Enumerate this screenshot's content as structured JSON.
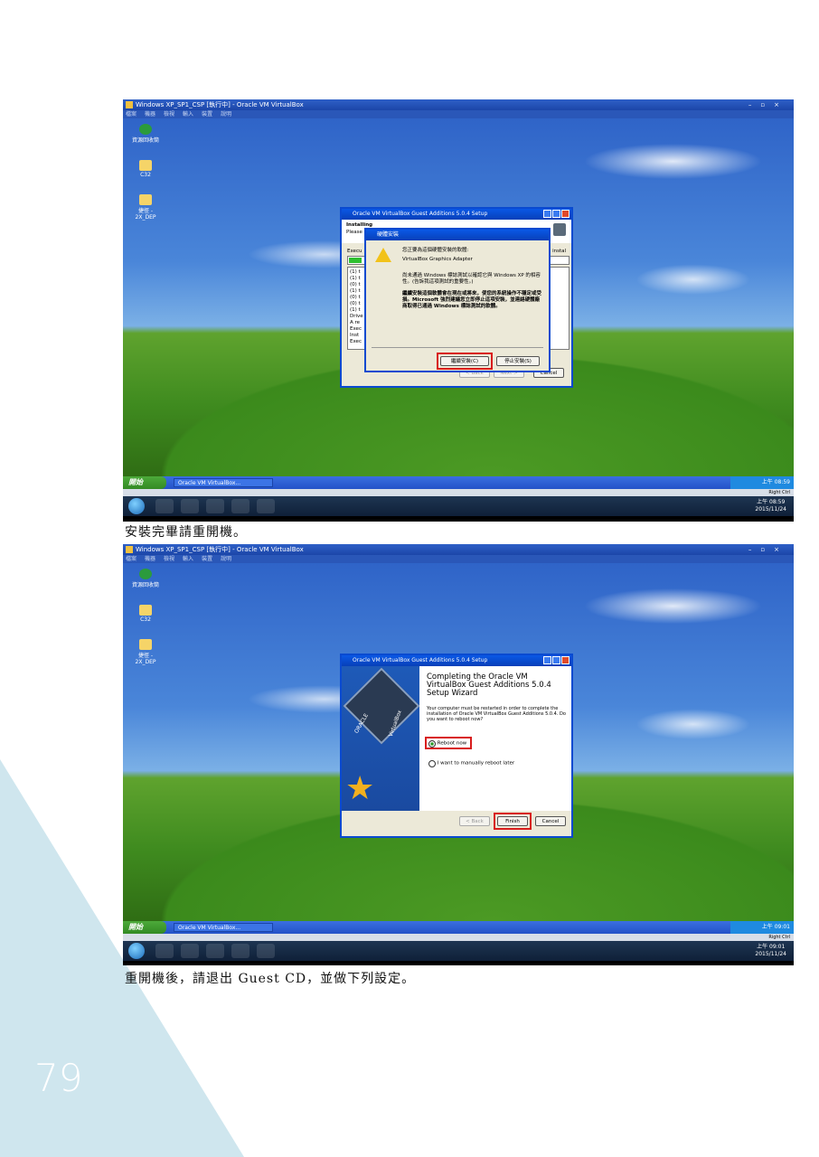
{
  "page_number": "79",
  "caption1": "安裝完畢請重開機。",
  "caption2": "重開機後，請退出 Guest CD，並做下列設定。",
  "vbox": {
    "title": "Windows XP_SP1_CSP [執行中] - Oracle VM VirtualBox",
    "menu": [
      "檔案",
      "機器",
      "檢視",
      "輸入",
      "裝置",
      "說明"
    ],
    "status_host_key": "Right Ctrl"
  },
  "xp": {
    "start_label": "開始",
    "task_button": "Oracle VM VirtualBox...",
    "icons": [
      "資源回收筒",
      "C32",
      "捷徑 - 2X_DEP"
    ],
    "clock1": "上午 08:59",
    "clock2": "上午 09:01"
  },
  "win7": {
    "time1": "上午 08:59",
    "date1": "2015/11/24",
    "time2": "上午 09:01",
    "date2": "2015/11/24"
  },
  "shot1": {
    "setup_title": "Oracle VM VirtualBox Guest Additions 5.0.4 Setup",
    "installing": "Installing",
    "please": "Please",
    "exec": "Execu",
    "install_fragment": "instal",
    "log_lines": [
      "(1) t",
      "(1) t",
      "(0) t",
      "(1) t",
      "(0) t",
      "(0) t",
      "(1) t",
      "Drive",
      "A re",
      "Exec",
      "Inst",
      "Exec"
    ],
    "btn_back": "< Back",
    "btn_next": "Next >",
    "btn_cancel": "Cancel",
    "hw_title": "硬體安裝",
    "hw_line1": "您正要為這個硬體安裝的軟體:",
    "hw_device": "VirtualBox Graphics Adapter",
    "hw_line2": "尚未通過 Windows 標誌測試以確認它與 Windows XP 的相容性。(告訴我這項測試的重要性。)",
    "hw_line3": "繼續安裝這個軟體會在現在或將來，使您的系統操作不穩定或受損。Microsoft 強烈建議您立即停止這項安裝，並連絡硬體廠商取得已通過 Windows 標誌測試的軟體。",
    "btn_continue": "繼續安裝(C)",
    "btn_stop": "停止安裝(S)"
  },
  "shot2": {
    "setup_title": "Oracle VM VirtualBox Guest Additions 5.0.4 Setup",
    "heading": "Completing the Oracle VM VirtualBox Guest Additions 5.0.4 Setup Wizard",
    "body": "Your computer must be restarted in order to complete the installation of Oracle VM VirtualBox Guest Additions 5.0.4. Do you want to reboot now?",
    "opt_reboot": "Reboot now",
    "opt_later": "I want to manually reboot later",
    "btn_back": "< Back",
    "btn_finish": "Finish",
    "btn_cancel": "Cancel",
    "box_label": "VirtualBox",
    "oracle_label": "ORACLE"
  }
}
